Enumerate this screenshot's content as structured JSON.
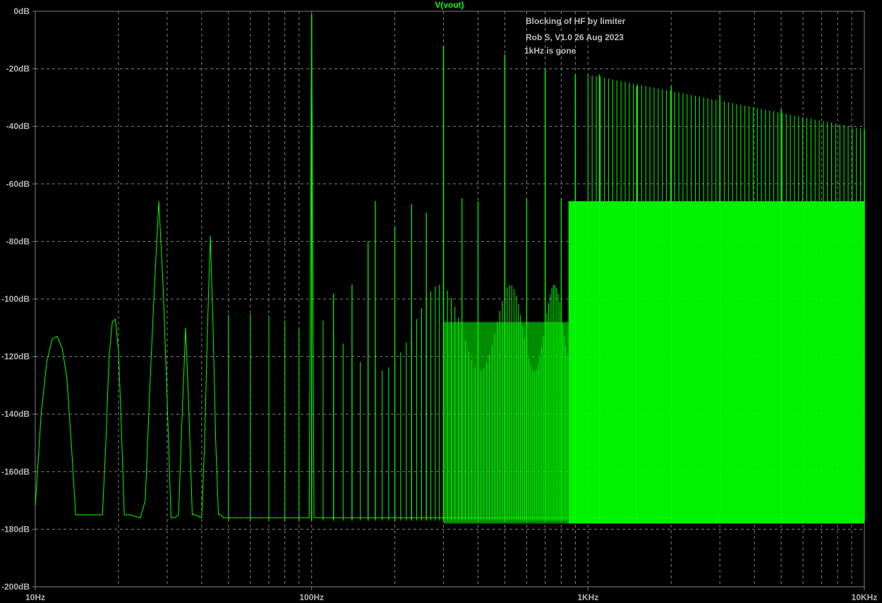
{
  "chart_data": {
    "type": "line",
    "title": "V(vout)",
    "xscale": "log",
    "xlim": [
      10,
      10000
    ],
    "ylim": [
      -200,
      0
    ],
    "grid": true,
    "x_tick_labels": [
      "10Hz",
      "100Hz",
      "1KHz",
      "10KHz"
    ],
    "x_ticks": [
      10,
      100,
      1000,
      10000
    ],
    "y_ticks": [
      0,
      -20,
      -40,
      -60,
      -80,
      -100,
      -120,
      -140,
      -160,
      -180,
      -200
    ],
    "y_tick_labels": [
      "0dB",
      "-20dB",
      "-40dB",
      "-60dB",
      "-80dB",
      "-100dB",
      "-120dB",
      "-140dB",
      "-160dB",
      "-180dB",
      "-200dB"
    ],
    "annotations": [
      "Blocking of HF by limiter",
      "Rob S, V1.0 26 Aug 2023",
      "1kHz is gone"
    ],
    "colors": {
      "trace": "#00ff00",
      "grid": "#808080",
      "labels": "#b4b4b4",
      "background": "#000000"
    },
    "series": [
      {
        "name": "V(vout)",
        "x": [
          10,
          10.5,
          11,
          11.5,
          12,
          12.5,
          13,
          13.5,
          14,
          15,
          16,
          17.5,
          18,
          18.5,
          19,
          19.5,
          20,
          20.5,
          21,
          22,
          24,
          25,
          26,
          27,
          28,
          29,
          30,
          31,
          32,
          33,
          34,
          35,
          36,
          37,
          38,
          40,
          41,
          42,
          43,
          44,
          45,
          46,
          47,
          48,
          50,
          52,
          54,
          55,
          56,
          57,
          58,
          60,
          62,
          64,
          66,
          67,
          68,
          70,
          72,
          75,
          78,
          80,
          85,
          88,
          90,
          95,
          98,
          100,
          102,
          105,
          110,
          120,
          130,
          140,
          150,
          160,
          170,
          180,
          200,
          220,
          250,
          300,
          350,
          400,
          500,
          600,
          700,
          800,
          900,
          1000,
          1200,
          1500,
          2000,
          3000,
          5000,
          7000,
          10000
        ],
        "values": [
          -172,
          -140,
          -122,
          -114,
          -113,
          -117,
          -127,
          -150,
          -175,
          -175,
          -175,
          -175,
          -150,
          -120,
          -108,
          -107,
          -118,
          -145,
          -175,
          -175,
          -176,
          -170,
          -130,
          -95,
          -66,
          -95,
          -135,
          -176,
          -176,
          -175,
          -140,
          -110,
          -140,
          -175,
          -175,
          -176,
          -150,
          -110,
          -78,
          -110,
          -150,
          -175,
          -175,
          -176,
          -176,
          -176,
          -176,
          -176,
          -176,
          -176,
          -176,
          -176,
          -176,
          -176,
          -176,
          -176,
          -176,
          -176,
          -176,
          -176,
          -176,
          -176,
          -176,
          -176,
          -176,
          -176,
          -176,
          -1,
          -176,
          -176,
          -176,
          -176,
          -176,
          -176,
          -176,
          -176,
          -176,
          -176,
          -176,
          -176,
          -176,
          -176,
          -176,
          -176,
          -176,
          -176,
          -176,
          -176,
          -176,
          -176,
          -176,
          -176,
          -176,
          -176,
          -176,
          -176,
          -176
        ]
      }
    ],
    "peaks": [
      {
        "f": 100,
        "db": -1
      },
      {
        "f": 300,
        "db": -12
      },
      {
        "f": 500,
        "db": -15
      },
      {
        "f": 700,
        "db": -20
      },
      {
        "f": 900,
        "db": -22
      },
      {
        "f": 1100,
        "db": -22
      },
      {
        "f": 1500,
        "db": -26
      },
      {
        "f": 2000,
        "db": -26
      },
      {
        "f": 3000,
        "db": -29
      },
      {
        "f": 5000,
        "db": -34
      },
      {
        "f": 10000,
        "db": -41
      }
    ],
    "sidebands": [
      {
        "f": 120,
        "db": -98
      },
      {
        "f": 140,
        "db": -95
      },
      {
        "f": 170,
        "db": -66
      },
      {
        "f": 160,
        "db": -80
      },
      {
        "f": 230,
        "db": -67
      },
      {
        "f": 260,
        "db": -70
      },
      {
        "f": 200,
        "db": -75
      },
      {
        "f": 350,
        "db": -65
      },
      {
        "f": 400,
        "db": -66
      },
      {
        "f": 600,
        "db": -65
      },
      {
        "f": 800,
        "db": -65
      }
    ],
    "floor_db": -177,
    "fill_start_f": 850,
    "fill_top_db": -66,
    "fill_bottom_db": -178
  }
}
